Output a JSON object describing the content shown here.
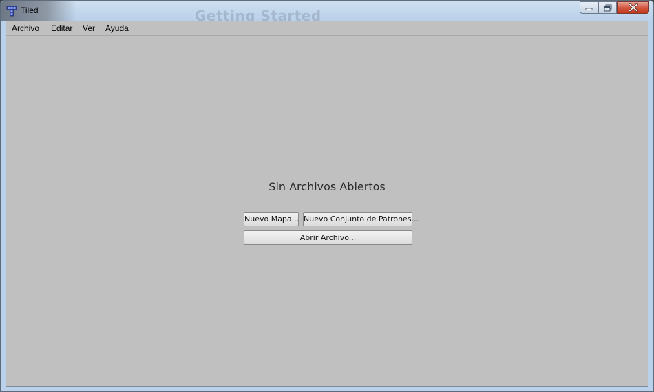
{
  "window": {
    "title": "Tiled",
    "background_ghost_text": "Getting Started"
  },
  "menu": [
    {
      "first": "A",
      "rest": "rchivo"
    },
    {
      "first": "E",
      "rest": "ditar"
    },
    {
      "first": "V",
      "rest": "er"
    },
    {
      "first": "A",
      "rest": "yuda"
    }
  ],
  "main": {
    "heading": "Sin Archivos Abiertos",
    "new_map_label": "Nuevo Mapa...",
    "new_tileset_label": "Nuevo Conjunto de Patrones...",
    "open_file_label": "Abrir Archivo..."
  },
  "icons": {
    "app": "tiled-app-icon",
    "minimize": "minimize-icon",
    "maximize": "maximize-icon",
    "close": "close-icon"
  },
  "colors": {
    "client_bg": "#c0c0c0",
    "titlebar": "#b9d1ea",
    "close_button": "#c2391f"
  }
}
